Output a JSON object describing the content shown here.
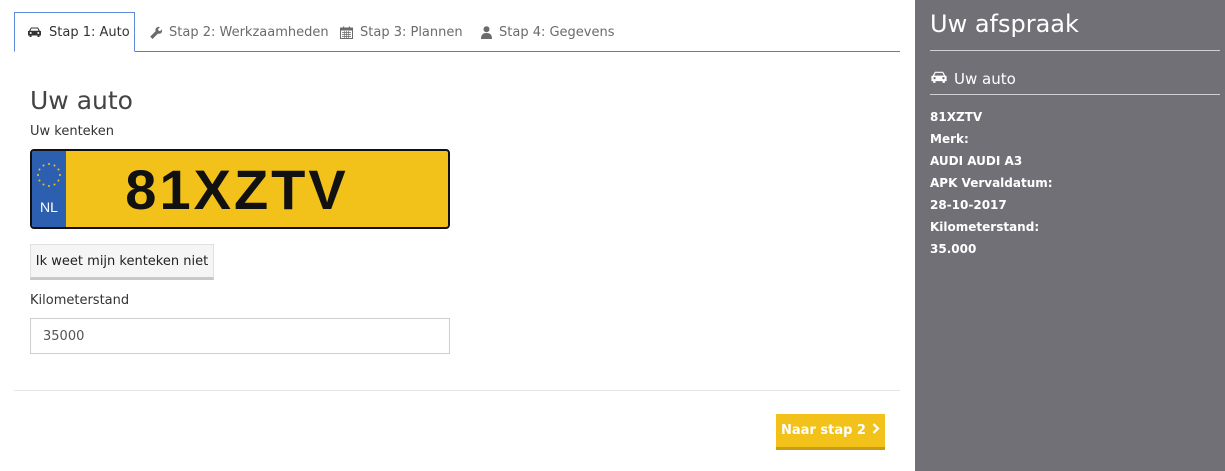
{
  "tabs": [
    {
      "label": "Stap 1: Auto",
      "icon": "car-icon",
      "active": true
    },
    {
      "label": "Stap 2: Werkzaamheden",
      "icon": "wrench-icon",
      "active": false
    },
    {
      "label": "Stap 3: Plannen",
      "icon": "calendar-icon",
      "active": false
    },
    {
      "label": "Stap 4: Gegevens",
      "icon": "user-icon",
      "active": false
    }
  ],
  "main": {
    "title": "Uw auto",
    "plate_label": "Uw kenteken",
    "plate": {
      "country": "NL",
      "number": "81XZTV"
    },
    "unknown_plate_button": "Ik weet mijn kenteken niet",
    "km_label": "Kilometerstand",
    "km_value": "35000",
    "next_button": "Naar stap 2"
  },
  "sidebar": {
    "title": "Uw afspraak",
    "subtitle": "Uw auto",
    "info": {
      "plate": "81XZTV",
      "brand_label": "Merk:",
      "brand_value": "AUDI AUDI A3",
      "apk_label": "APK Vervaldatum:",
      "apk_value": "28-10-2017",
      "km_label": "Kilometerstand:",
      "km_value": "35.000"
    }
  },
  "colors": {
    "accent_yellow": "#f2c21b",
    "sidebar_bg": "#727077",
    "active_tab_border": "#5b8ad6",
    "eu_blue": "#2d5fb0"
  }
}
